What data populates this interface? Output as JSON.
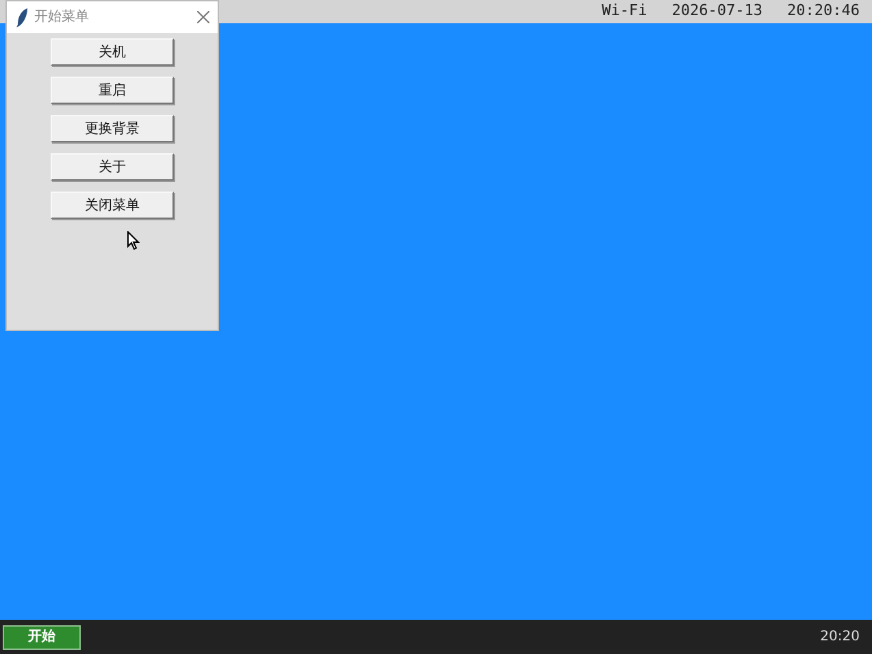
{
  "top_bar": {
    "wifi": "Wi-Fi",
    "date": "2026-07-13",
    "time": "20:20:46"
  },
  "window": {
    "title": "开始菜单",
    "buttons": [
      "关机",
      "重启",
      "更换背景",
      "关于",
      "关闭菜单"
    ]
  },
  "taskbar": {
    "start_button": "开始",
    "clock": "20:20"
  }
}
